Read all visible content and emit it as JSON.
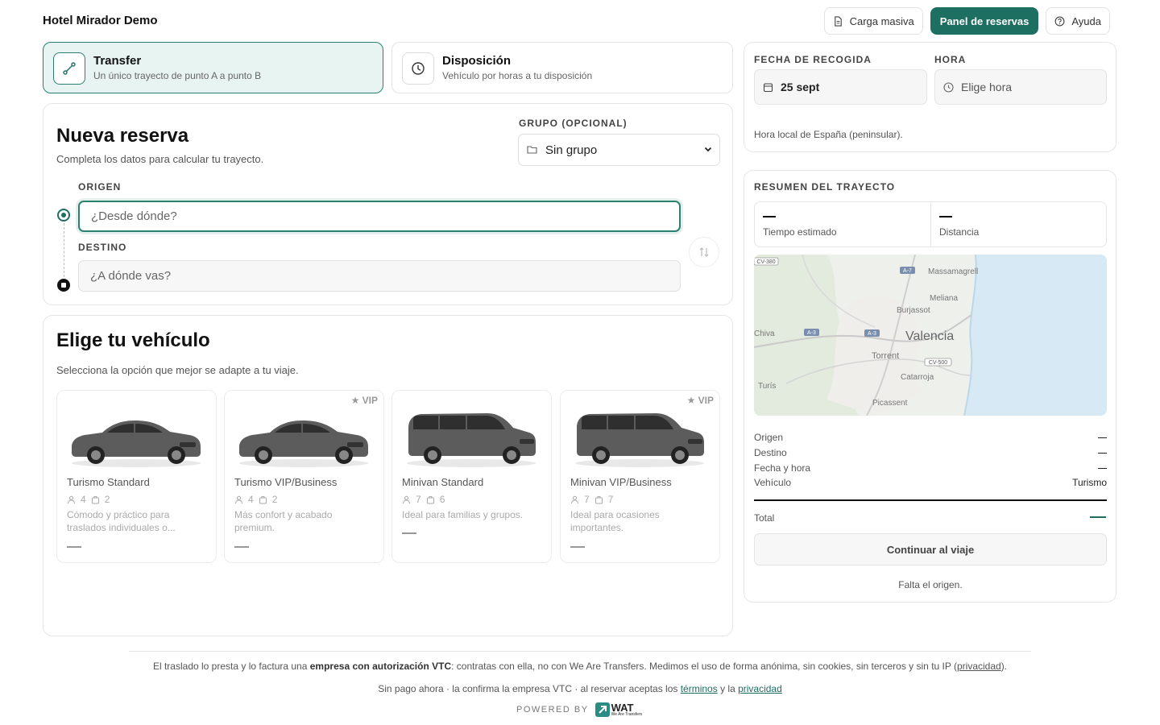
{
  "header": {
    "brand": "Hotel Mirador Demo",
    "bulk_label": "Carga masiva",
    "panel_label": "Panel de reservas",
    "help_label": "Ayuda"
  },
  "modes": [
    {
      "title": "Transfer",
      "subtitle": "Un único trayecto de punto A a punto B",
      "icon": "route-icon",
      "active": true
    },
    {
      "title": "Disposición",
      "subtitle": "Vehículo por horas a tu disposición",
      "icon": "clock-icon",
      "active": false
    }
  ],
  "booking": {
    "title": "Nueva reserva",
    "subtitle": "Completa los datos para calcular tu trayecto.",
    "group_label": "GRUPO (OPCIONAL)",
    "group_value": "Sin grupo",
    "origin_label": "ORIGEN",
    "origin_placeholder": "¿Desde dónde?",
    "destination_label": "DESTINO",
    "destination_placeholder": "¿A dónde vas?"
  },
  "vehicles": {
    "title": "Elige tu vehículo",
    "subtitle": "Selecciona la opción que mejor se adapte a tu viaje.",
    "items": [
      {
        "name": "Turismo Standard",
        "passengers": "4",
        "bags": "2",
        "desc": "Cómodo y práctico para traslados individuales o...",
        "badge": "",
        "kind": "sedan"
      },
      {
        "name": "Turismo VIP/Business",
        "passengers": "4",
        "bags": "2",
        "desc": "Más confort y acabado premium.",
        "badge": "★ VIP",
        "kind": "sedan"
      },
      {
        "name": "Minivan Standard",
        "passengers": "7",
        "bags": "6",
        "desc": "Ideal para familias y grupos.",
        "badge": "",
        "kind": "van"
      },
      {
        "name": "Minivan VIP/Business",
        "passengers": "7",
        "bags": "7",
        "desc": "Ideal para ocasiones importantes.",
        "badge": "★ VIP",
        "kind": "van"
      }
    ]
  },
  "pickup": {
    "date_label": "FECHA DE RECOGIDA",
    "date_value": "25 sept",
    "time_label": "HORA",
    "time_placeholder": "Elige hora",
    "hint": "Hora local de España (peninsular)."
  },
  "summary": {
    "title": "RESUMEN DEL TRAYECTO",
    "est_time_label": "Tiempo estimado",
    "distance_label": "Distancia",
    "map_labels": {
      "cv380": "CV-380",
      "a7": "A-7",
      "massamagrell": "Massamagrell",
      "meliana": "Meliana",
      "burjassot": "Burjassot",
      "chiva": "Chiva",
      "a3a": "A-3",
      "a3b": "A-3",
      "valencia": "Valencia",
      "torrent": "Torrent",
      "cv500": "CV-500",
      "catarroja": "Catarroja",
      "turis": "Turís",
      "picassent": "Picassent"
    },
    "rows": [
      {
        "label": "Origen",
        "value": ""
      },
      {
        "label": "Destino",
        "value": ""
      },
      {
        "label": "Fecha y hora",
        "value": ""
      },
      {
        "label": "Vehículo",
        "value": "Turismo"
      }
    ],
    "total_label": "Total",
    "continue_label": "Continuar al viaje",
    "missing": "Falta el origen."
  },
  "footer": {
    "line1_a": "El traslado lo presta y lo factura una ",
    "line1_b": "empresa con autorización VTC",
    "line1_c": ": contratas con ella, no con We Are Transfers. Medimos el uso de forma anónima, sin cookies, sin terceros y sin tu IP (",
    "line1_link": "privacidad",
    "line1_d": ").",
    "line2_a": "Sin pago ahora · la confirma la empresa VTC · al reservar aceptas los ",
    "terms": "términos",
    "line2_b": " y la ",
    "privacy": "privacidad",
    "powered": "POWERED BY",
    "logo_text": "WAT",
    "logo_tag": "We Are Transfers"
  },
  "colors": {
    "accent": "#1d6f62",
    "accent_light": "#e7f4f1",
    "sea": "#d6e9f5"
  }
}
